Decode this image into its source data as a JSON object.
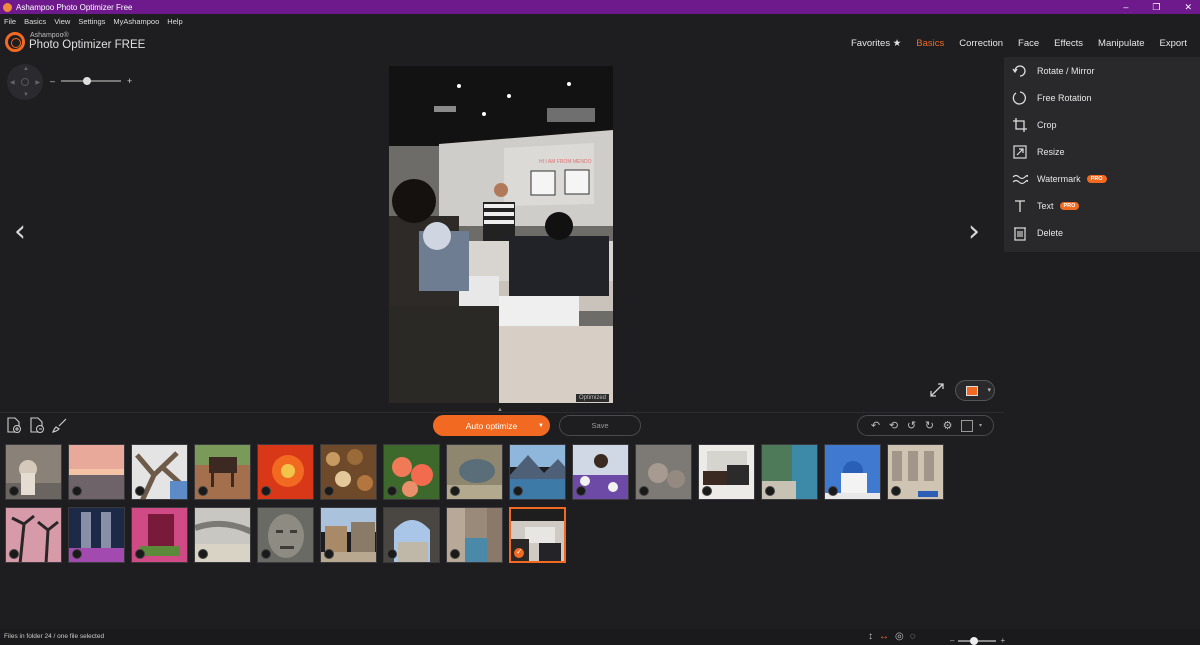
{
  "window": {
    "title": "Ashampoo Photo Optimizer Free",
    "controls": [
      "–",
      "❐",
      "✕"
    ]
  },
  "menu": [
    "File",
    "Basics",
    "View",
    "Settings",
    "MyAshampoo",
    "Help"
  ],
  "logo": {
    "brand": "Ashampoo®",
    "product": "Photo Optimizer FREE"
  },
  "tabs": [
    {
      "label": "Favorites ★",
      "active": false
    },
    {
      "label": "Basics",
      "active": true
    },
    {
      "label": "Correction",
      "active": false
    },
    {
      "label": "Face",
      "active": false
    },
    {
      "label": "Effects",
      "active": false
    },
    {
      "label": "Manipulate",
      "active": false
    },
    {
      "label": "Export",
      "active": false
    }
  ],
  "zoom": {
    "minus": "–",
    "plus": "+"
  },
  "viewer": {
    "badge": "Optimized",
    "prev": "‹",
    "next": "›",
    "slide_text": "HI I AM FROM MENDO"
  },
  "side_panel": {
    "items": [
      {
        "label": "Rotate / Mirror",
        "icon": "rotate-icon",
        "pro": false
      },
      {
        "label": "Free Rotation",
        "icon": "free-rotation-icon",
        "pro": false
      },
      {
        "label": "Crop",
        "icon": "crop-icon",
        "pro": false
      },
      {
        "label": "Resize",
        "icon": "resize-icon",
        "pro": false
      },
      {
        "label": "Watermark",
        "icon": "watermark-icon",
        "pro": true
      },
      {
        "label": "Text",
        "icon": "text-icon",
        "pro": true
      },
      {
        "label": "Delete",
        "icon": "trash-icon",
        "pro": false
      }
    ],
    "pro_label": "PRO"
  },
  "toolbar": {
    "auto_optimize": "Auto optimize",
    "save": "Save"
  },
  "thumbnails": {
    "row1": [
      "cat",
      "sunset",
      "tree",
      "horses",
      "flower",
      "nuts",
      "roses",
      "rocks",
      "lake",
      "girl-flowers",
      "monkeys",
      "horse-carriage",
      "coast",
      "church",
      "street"
    ],
    "row2": [
      "palms",
      "tower",
      "pink-door",
      "beach",
      "stone-face",
      "village",
      "arch",
      "canal",
      "classroom"
    ],
    "selected": "classroom"
  },
  "status": {
    "text": "Files in folder 24 / one file selected"
  },
  "colors": {
    "accent": "#f26a21",
    "titlebar": "#6e1a8d",
    "background": "#1e1e21",
    "panel": "#29292c"
  }
}
